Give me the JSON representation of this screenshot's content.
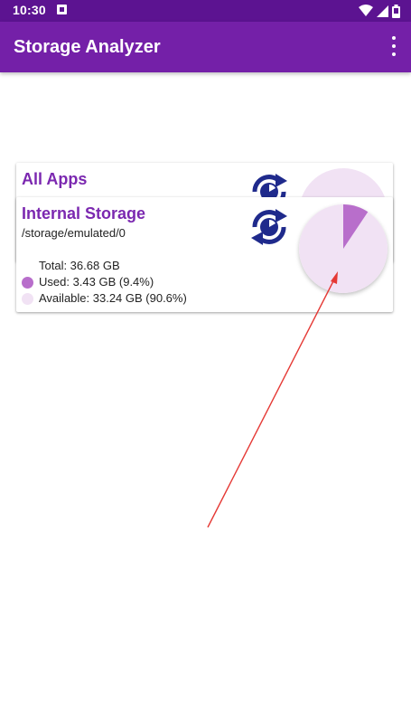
{
  "status_bar": {
    "time": "10:30",
    "icons": [
      "notification-icon",
      "wifi-icon",
      "signal-icon",
      "battery-icon"
    ]
  },
  "app_bar": {
    "title": "Storage Analyzer",
    "menu_icon": "more-vert-icon"
  },
  "cards": [
    {
      "title": "All Apps",
      "refresh_icon": "refresh-storage-icon"
    },
    {
      "title": "Internal Storage",
      "path": "/storage/emulated/0",
      "refresh_icon": "refresh-storage-icon",
      "total": "Total: 36.68 GB",
      "used": "Used: 3.43 GB (9.4%)",
      "available": "Available: 33.24 GB (90.6%)",
      "used_fraction": 0.094
    }
  ],
  "colors": {
    "status_bar": "#5c1391",
    "app_bar": "#7420a8",
    "title_purple": "#7b28b0",
    "used": "#b86ecb",
    "available": "#f1e2f4",
    "refresh_icon": "#1f2a8c",
    "annotation_arrow": "#e53935"
  }
}
